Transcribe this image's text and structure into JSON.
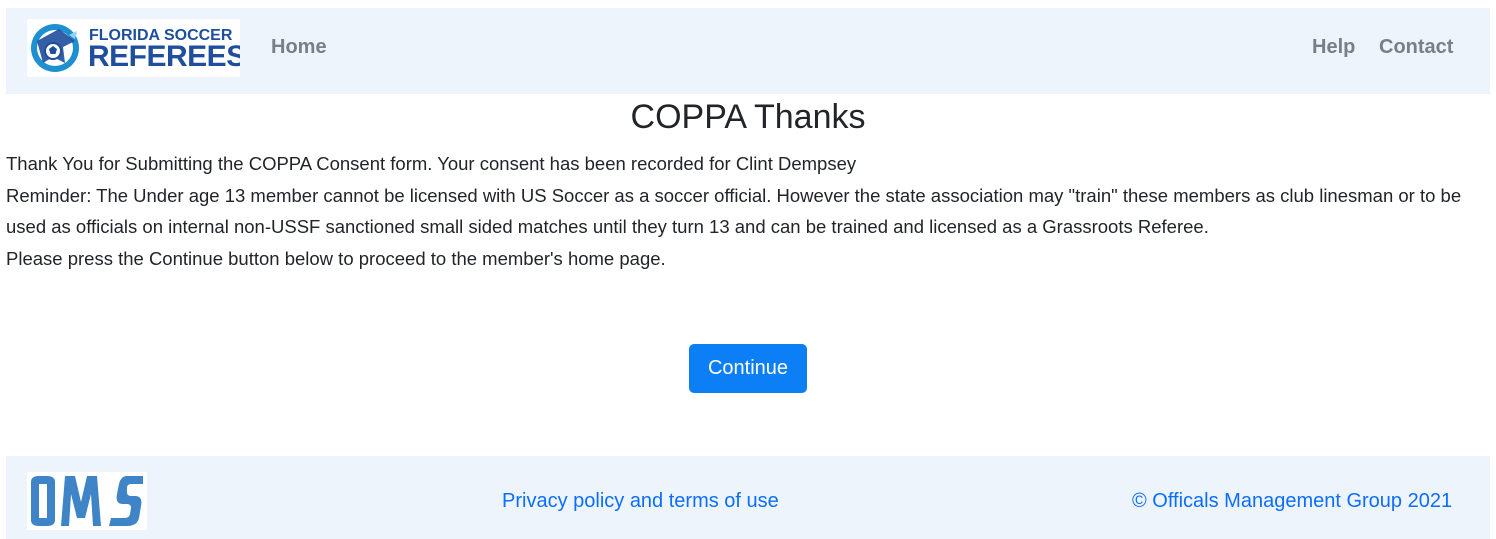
{
  "header": {
    "brand_line1": "FLORIDA SOCCER",
    "brand_line2": "REFEREES",
    "nav_home": "Home",
    "nav_help": "Help",
    "nav_contact": "Contact"
  },
  "main": {
    "title": "COPPA Thanks",
    "paragraphs": [
      "Thank You for Submitting the COPPA Consent form. Your consent has been recorded for Clint Dempsey",
      "Reminder: The Under age 13 member cannot be licensed with US Soccer as a soccer official. However the state association may \"train\" these members as club linesman or to be used as officials on internal non-USSF sanctioned small sided matches until they turn 13 and can be trained and licensed as a Grassroots Referee.",
      "Please press the Continue button below to proceed to  the member's home page."
    ],
    "continue_label": "Continue"
  },
  "footer": {
    "logo_text": "OMS",
    "privacy_link": "Privacy policy and terms of use",
    "copyright": "© Officals Management Group 2021"
  },
  "colors": {
    "navbar_bg": "#edf4fc",
    "primary": "#0d7ff6",
    "link": "#0d6efd",
    "brand": "#1e4e9c"
  },
  "icons": {
    "brand_logo": "florida-soccer-referees-logo",
    "footer_logo": "oms-logo"
  }
}
